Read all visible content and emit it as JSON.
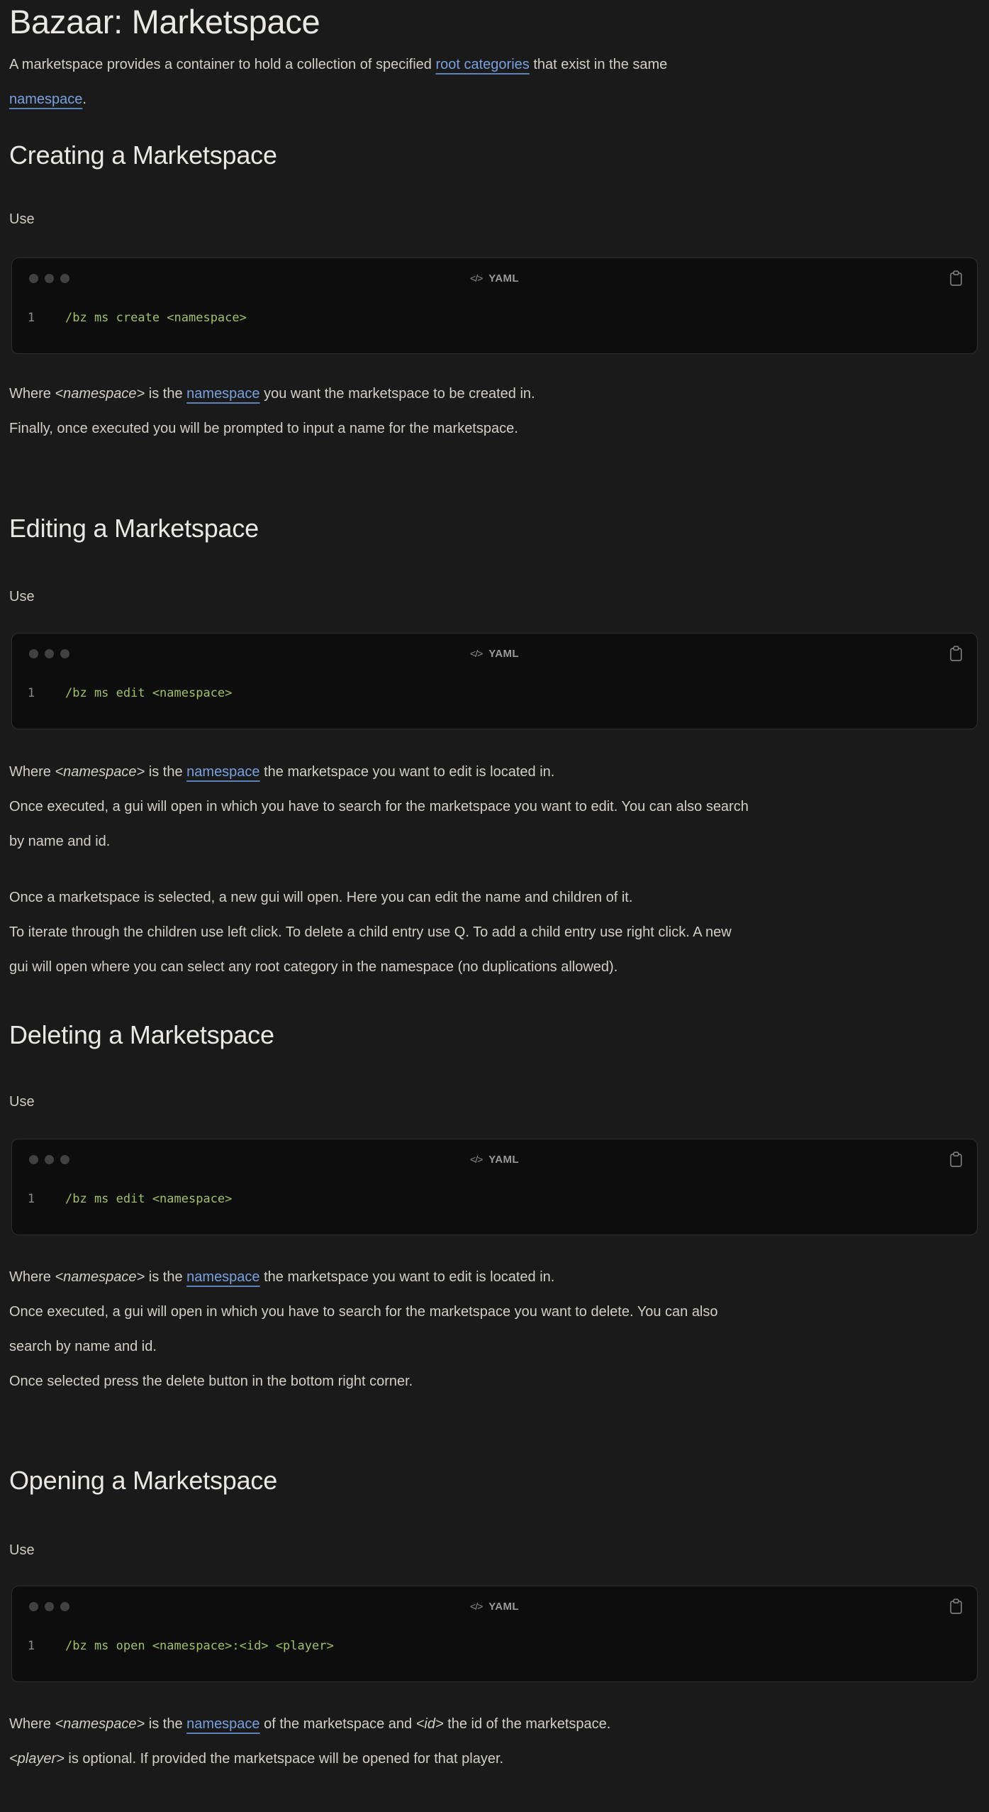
{
  "page": {
    "title": "Bazaar: Marketspace"
  },
  "labels": {
    "use": "Use",
    "lang": "YAML",
    "lang_icon": "</>",
    "line_no": "1"
  },
  "colors": {
    "background": "#1a1a1a",
    "code_block_bg": "#0d0d0d",
    "code_text": "#a3c065",
    "link": "#79a1df",
    "heading": "#eae8e5",
    "body_text": "#d2cfc9"
  },
  "intro": {
    "s1": "A marketspace provides a container to hold a collection of specified ",
    "link_root_categories": "root categories",
    "s2": " that exist in the same",
    "link_namespace": "namespace",
    "s3": "."
  },
  "creating": {
    "heading": "Creating a Marketspace",
    "code": "/bz ms create <namespace>",
    "where": {
      "s1": "Where ",
      "var": "<namespace>",
      "s2": " is the ",
      "link": "namespace",
      "s3": " you want the marketspace to be created in."
    },
    "finally_line": "Finally, once executed you will be prompted to input a name for the marketspace."
  },
  "editing": {
    "heading": "Editing a Marketspace",
    "code": "/bz ms edit <namespace>",
    "where": {
      "s1": "Where ",
      "var": "<namespace>",
      "s2": " is the ",
      "link": "namespace",
      "s3": " the marketspace you want to edit is located in."
    },
    "once_line1": "Once executed, a gui will open in which you have to search for the marketspace you want to edit. You can also search",
    "once_line2": "by name and id.",
    "selected_line": "Once a marketspace is selected, a new gui will open. Here you can edit the name and children of it.",
    "iterate_line1": "To iterate through the children use left click. To delete a child entry use Q. To add a child entry use right click. A new",
    "iterate_line2": "gui will open where you can select any root category in the namespace (no duplications allowed)."
  },
  "deleting": {
    "heading": "Deleting a Marketspace",
    "code": "/bz ms edit <namespace>",
    "where": {
      "s1": "Where ",
      "var": "<namespace>",
      "s2": " is the ",
      "link": "namespace",
      "s3": " the marketspace you want to edit is located in."
    },
    "once_line1": "Once executed, a gui will open in which you have to search for the marketspace you want to delete. You can also",
    "once_line2": "search by name and id.",
    "selected_line": "Once selected press the delete button in the bottom right corner."
  },
  "opening": {
    "heading": "Opening a Marketspace",
    "code": "/bz ms open <namespace>:<id> <player>",
    "where": {
      "s1": "Where ",
      "var1": "<namespace>",
      "s2": " is the ",
      "link": "namespace",
      "s3": " of the marketspace and ",
      "var2": "<id>",
      "s4": " the id of the marketspace."
    },
    "player": {
      "var": "<player>",
      "s1": " is optional. If provided the marketspace will be opened for that player."
    }
  }
}
